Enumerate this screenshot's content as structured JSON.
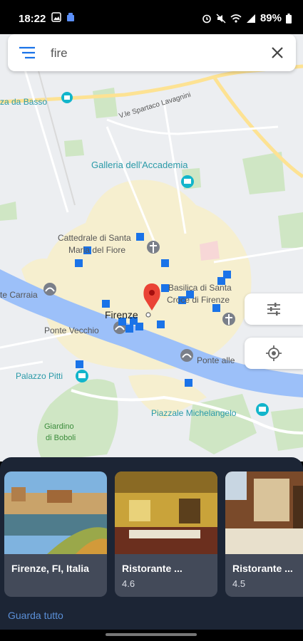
{
  "status_bar": {
    "time": "18:22",
    "battery": "89%"
  },
  "search": {
    "value": "fire",
    "placeholder": ""
  },
  "map": {
    "labels": {
      "piazza_da_basso": "za da Basso",
      "viale": "V.le Spartaco Lavagnini",
      "accademia": "Galleria dell'Accademia",
      "cattedrale1": "Cattedrale di Santa",
      "cattedrale2": "Maria del Fiore",
      "basilica1": "Basilica di Santa",
      "basilica2": "Croce di Firenze",
      "carraia": "te Carraia",
      "firenze": "Firenze",
      "ponte_vecchio": "Ponte Vecchio",
      "ponte_alle": "Ponte alle",
      "pitti": "Palazzo Pitti",
      "michelangelo": "Piazzale Michelangelo",
      "boboli1": "Giardino",
      "boboli2": "di Boboli"
    }
  },
  "results": [
    {
      "title": "Firenze, FI, Italia",
      "rating": ""
    },
    {
      "title": "Ristorante ...",
      "rating": "4.6"
    },
    {
      "title": "Ristorante ...",
      "rating": "4.5"
    }
  ],
  "see_all_label": "Guarda tutto",
  "colors": {
    "accent": "#1a73e8",
    "panel": "#1c2535",
    "card": "#434a59",
    "link": "#5b90d8",
    "pin": "#ea4335"
  }
}
